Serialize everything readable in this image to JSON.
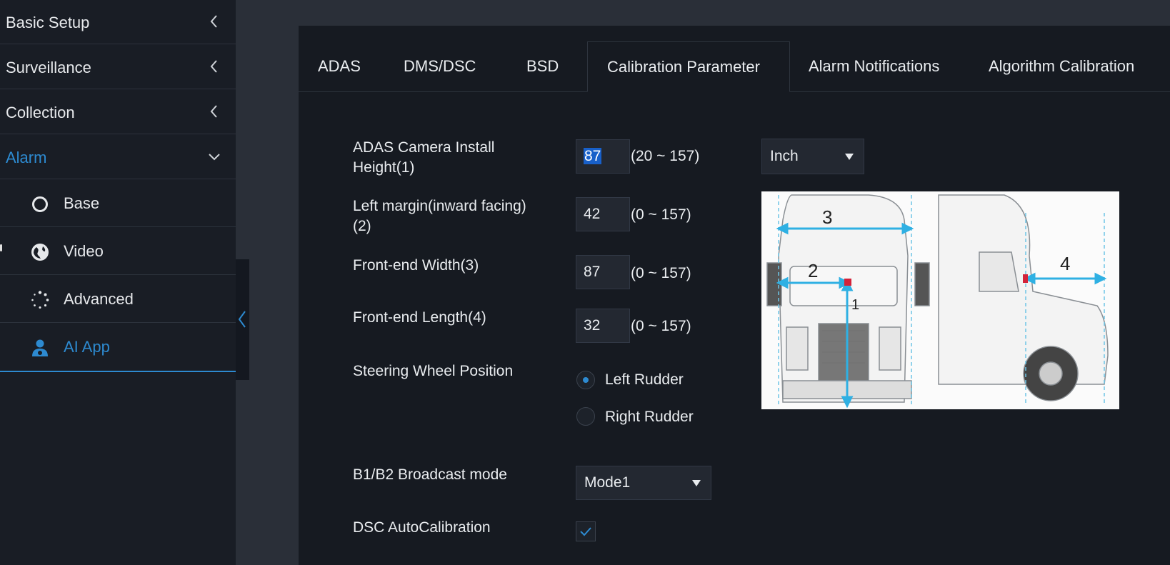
{
  "sidebar": {
    "items": [
      {
        "label": "Basic Setup"
      },
      {
        "label": "Surveillance"
      },
      {
        "label": "Collection"
      },
      {
        "label": "Alarm"
      }
    ],
    "sub_items": [
      {
        "label": "Base",
        "icon": "circle-icon"
      },
      {
        "label": "Video",
        "icon": "globe-icon"
      },
      {
        "label": "Advanced",
        "icon": "dotted-circle-icon"
      },
      {
        "label": "AI App",
        "icon": "ai-user-icon"
      }
    ],
    "accent_color": "#2d8ad0"
  },
  "tabs": [
    {
      "label": "ADAS"
    },
    {
      "label": "DMS/DSC"
    },
    {
      "label": "BSD"
    },
    {
      "label": "Calibration Parameter"
    },
    {
      "label": "Alarm Notifications"
    },
    {
      "label": "Algorithm Calibration"
    }
  ],
  "form": {
    "camera_height": {
      "label_line1": "ADAS Camera Install",
      "label_line2": "Height(1)",
      "value": "87",
      "range": "(20 ~ 157)"
    },
    "unit": {
      "value": "Inch"
    },
    "left_margin": {
      "label_line1": "Left margin(inward facing)",
      "label_line2": "(2)",
      "value": "42",
      "range": "(0 ~ 157)"
    },
    "front_width": {
      "label": "Front-end Width(3)",
      "value": "87",
      "range": "(0 ~ 157)"
    },
    "front_length": {
      "label": "Front-end Length(4)",
      "value": "32",
      "range": "(0 ~ 157)"
    },
    "steering": {
      "label": "Steering Wheel Position",
      "options": [
        "Left Rudder",
        "Right Rudder"
      ],
      "selected": "Left Rudder"
    },
    "broadcast": {
      "label": "B1/B2 Broadcast mode",
      "value": "Mode1"
    },
    "dsc_auto": {
      "label": "DSC AutoCalibration",
      "checked": true
    }
  },
  "diagram": {
    "markers": [
      "3",
      "2",
      "1",
      "4"
    ]
  }
}
